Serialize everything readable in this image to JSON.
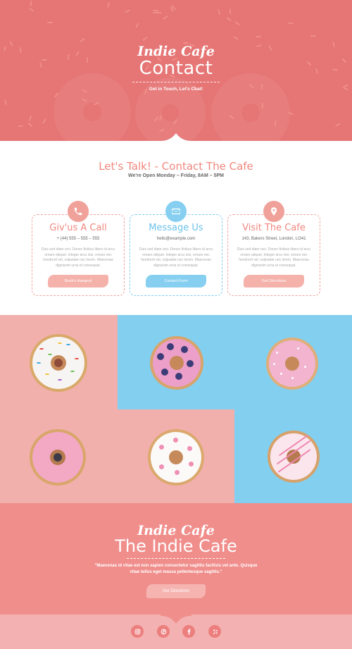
{
  "hero": {
    "script_title": "Indie Cafe",
    "title": "Contact",
    "subtitle": "Get in Touch, Let's Chat!"
  },
  "talk": {
    "title": "Let's Talk! - Contact The Cafe",
    "hours": "We're Open Monday – Friday, 8AM – 5PM"
  },
  "cards": [
    {
      "icon": "phone-icon",
      "title": "Giv'us A Call",
      "info": "+ (44) 555 – 555 – 555",
      "body": "Duis sed diam orci. Donec finibus libero id arcu ornare aliquet. Integer arcu nisi, ornare nec hendrerit vel, vulputate nec lorem. Maecenas dignissim urna et consequat.",
      "button": "Book's Hangout"
    },
    {
      "icon": "envelope-icon",
      "title": "Message Us",
      "info": "hello@example.com",
      "body": "Duis sed diam orci. Donec finibus libero id arcu ornare aliquet. Integer arcu nisi, ornare nec hendrerit vel, vulputate nec lorem. Maecenas dignissim urna et consequat.",
      "button": "Contact Form"
    },
    {
      "icon": "map-pin-icon",
      "title": "Visit The Cafe",
      "info": "143, Bakers Street, London, LO41",
      "body": "Duis sed diam orci. Donec finibus libero id arcu ornare aliquet. Integer arcu nisi, ornare nec hendrerit vel, vulputate nec lorem. Maecenas dignissim urna et consequat.",
      "button": "Get Directions"
    }
  ],
  "cafe": {
    "script_title": "Indie Cafe",
    "title": "The Indie Cafe",
    "quote": "\"Maecenas id vitae  est non sapien consectetur sagittis facilisis vel ante. Quisque vitae tellus eget massa pellentesque sagittis.\"",
    "button": "Get Directions"
  },
  "social": [
    "instagram-icon",
    "pinterest-icon",
    "facebook-icon",
    "yelp-icon"
  ],
  "colors": {
    "primary_coral": "#e67575",
    "accent_pink": "#f1877e",
    "light_pink": "#f2b0ad",
    "sky_blue": "#82cfef"
  }
}
